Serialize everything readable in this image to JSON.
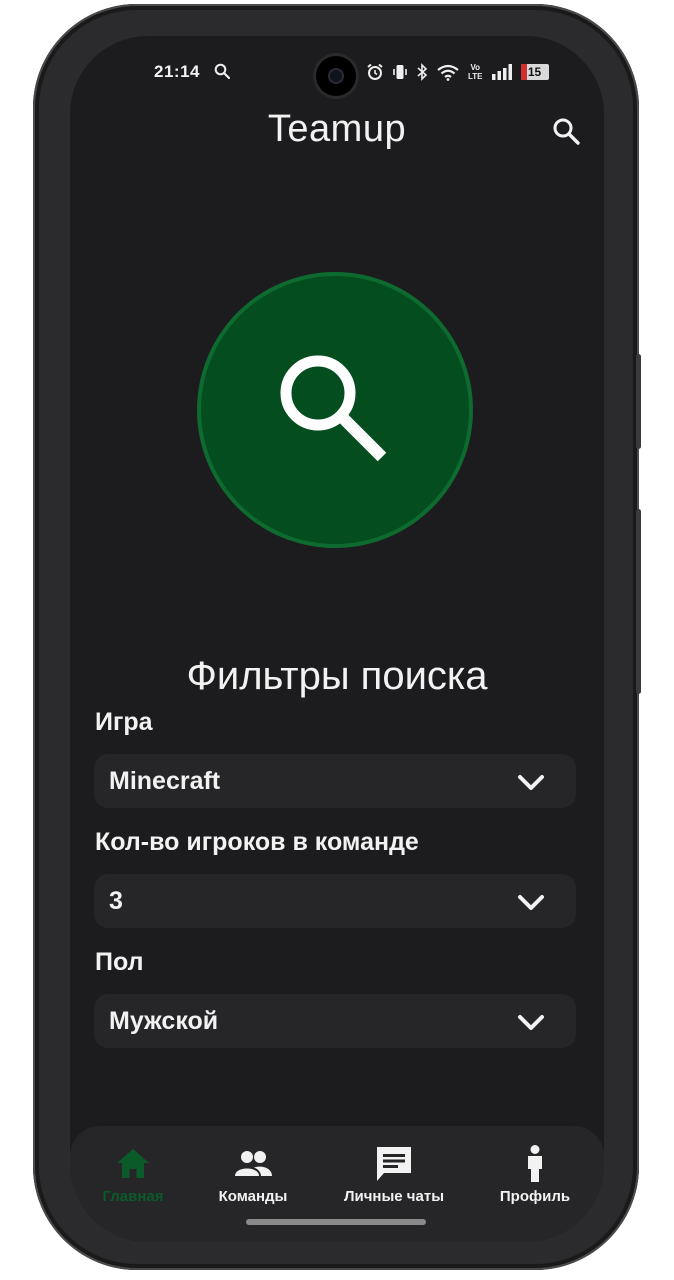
{
  "status_bar": {
    "time": "21:14",
    "network_badge_top": "Vo",
    "network_badge_bottom": "LTE",
    "battery": "15"
  },
  "app_bar": {
    "title": "Teamup"
  },
  "filters": {
    "title": "Фильтры поиска",
    "game": {
      "label": "Игра",
      "value": "Minecraft"
    },
    "team_size": {
      "label": "Кол-во игроков в команде",
      "value": "3"
    },
    "gender": {
      "label": "Пол",
      "value": "Мужской"
    }
  },
  "nav": {
    "items": [
      {
        "label": "Главная",
        "icon": "home-icon",
        "active": true
      },
      {
        "label": "Команды",
        "icon": "people-icon",
        "active": false
      },
      {
        "label": "Личные чаты",
        "icon": "chat-icon",
        "active": false
      },
      {
        "label": "Профиль",
        "icon": "person-icon",
        "active": false
      }
    ]
  },
  "colors": {
    "accent": "#034d1f",
    "accent_ring": "#0d6b30",
    "active_nav": "#0b5a2a",
    "background": "#1c1c1e",
    "surface": "#262628"
  }
}
